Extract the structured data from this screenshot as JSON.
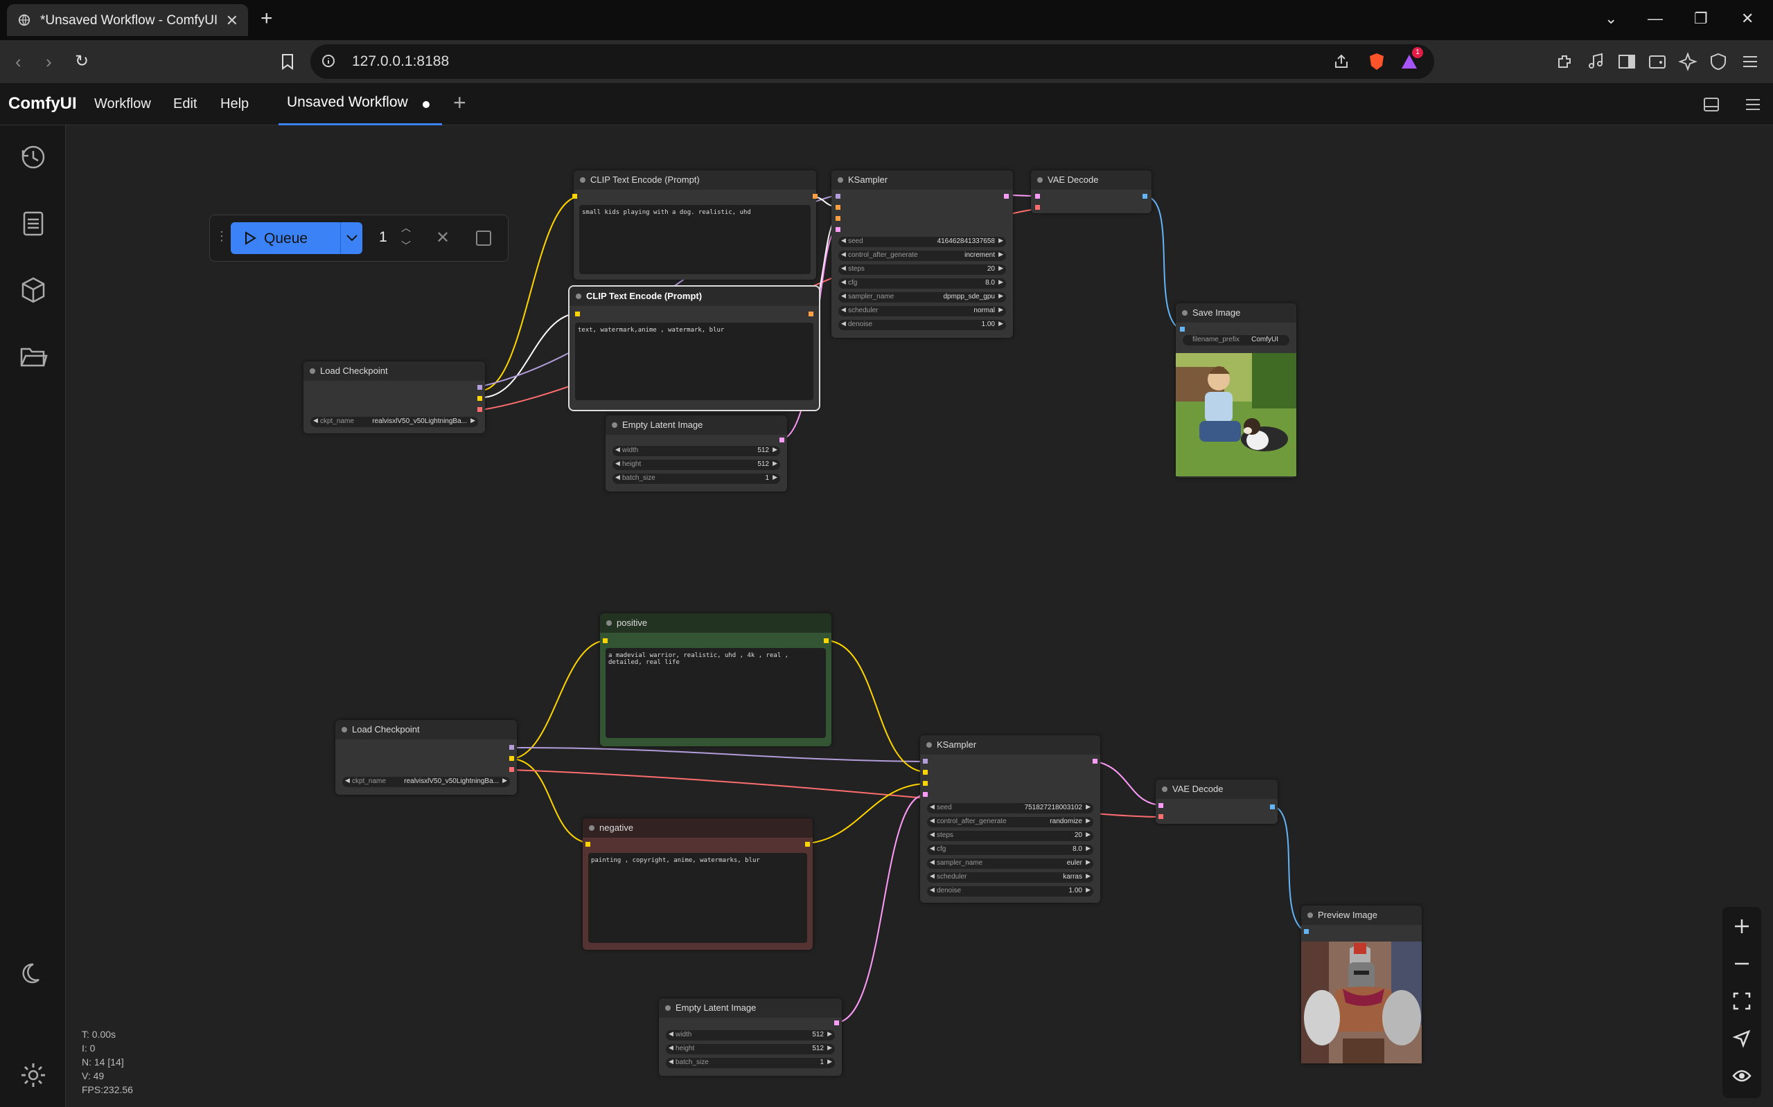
{
  "browser": {
    "tab_title": "*Unsaved Workflow - ComfyUI",
    "url": "127.0.0.1:8188",
    "notification_badge": "1"
  },
  "menubar": {
    "brand": "ComfyUI",
    "items": [
      "Workflow",
      "Edit",
      "Help"
    ],
    "workflow_tab": "Unsaved Workflow"
  },
  "queue": {
    "label": "Queue",
    "count": "1"
  },
  "nodes": {
    "clip_pos_top": {
      "title": "CLIP Text Encode (Prompt)",
      "text": "small kids playing with a dog. realistic, uhd"
    },
    "clip_neg_top": {
      "title": "CLIP Text Encode (Prompt)",
      "text": "text, watermark,anime , watermark, blur"
    },
    "ksampler_top": {
      "title": "KSampler",
      "widgets": [
        {
          "label": "seed",
          "value": "416462841337658"
        },
        {
          "label": "control_after_generate",
          "value": "increment"
        },
        {
          "label": "steps",
          "value": "20"
        },
        {
          "label": "cfg",
          "value": "8.0"
        },
        {
          "label": "sampler_name",
          "value": "dpmpp_sde_gpu"
        },
        {
          "label": "scheduler",
          "value": "normal"
        },
        {
          "label": "denoise",
          "value": "1.00"
        }
      ]
    },
    "vae_top": {
      "title": "VAE Decode"
    },
    "save_image": {
      "title": "Save Image",
      "prefix_label": "filename_prefix",
      "prefix_value": "ComfyUI"
    },
    "load_ckpt_top": {
      "title": "Load Checkpoint",
      "label": "ckpt_name",
      "value": "realvisxlV50_v50LightningBa..."
    },
    "empty_latent_top": {
      "title": "Empty Latent Image",
      "widgets": [
        {
          "label": "width",
          "value": "512"
        },
        {
          "label": "height",
          "value": "512"
        },
        {
          "label": "batch_size",
          "value": "1"
        }
      ]
    },
    "positive": {
      "title": "positive",
      "text": "a madevial warrior, realistic, uhd , 4k , real , detailed, real life"
    },
    "negative": {
      "title": "negative",
      "text": "painting , copyright, anime, watermarks, blur"
    },
    "load_ckpt_bot": {
      "title": "Load Checkpoint",
      "label": "ckpt_name",
      "value": "realvisxlV50_v50LightningBa..."
    },
    "ksampler_bot": {
      "title": "KSampler",
      "widgets": [
        {
          "label": "seed",
          "value": "751827218003102"
        },
        {
          "label": "control_after_generate",
          "value": "randomize"
        },
        {
          "label": "steps",
          "value": "20"
        },
        {
          "label": "cfg",
          "value": "8.0"
        },
        {
          "label": "sampler_name",
          "value": "euler"
        },
        {
          "label": "scheduler",
          "value": "karras"
        },
        {
          "label": "denoise",
          "value": "1.00"
        }
      ]
    },
    "vae_bot": {
      "title": "VAE Decode"
    },
    "preview": {
      "title": "Preview Image"
    },
    "empty_latent_bot": {
      "title": "Empty Latent Image",
      "widgets": [
        {
          "label": "width",
          "value": "512"
        },
        {
          "label": "height",
          "value": "512"
        },
        {
          "label": "batch_size",
          "value": "1"
        }
      ]
    }
  },
  "stats": [
    "T: 0.00s",
    "I: 0",
    "N: 14 [14]",
    "V: 49",
    "FPS:232.56"
  ],
  "colors": {
    "clip_wire": "#ffd500",
    "model_wire": "#b39ddb",
    "vae_wire": "#ff6e6e",
    "latent_wire": "#ff9cf9",
    "image_wire": "#64b5f6",
    "accent": "#3b82f6"
  }
}
